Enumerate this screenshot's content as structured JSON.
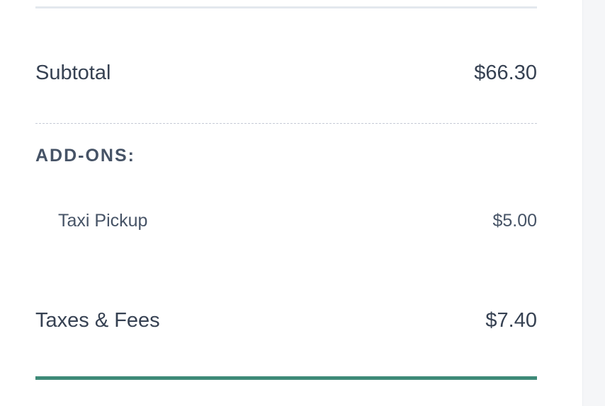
{
  "summary": {
    "subtotal": {
      "label": "Subtotal",
      "value": "$66.30"
    },
    "addons": {
      "heading": "ADD-ONS:",
      "items": [
        {
          "label": "Taxi Pickup",
          "value": "$5.00"
        }
      ]
    },
    "taxes": {
      "label": "Taxes & Fees",
      "value": "$7.40"
    }
  },
  "colors": {
    "text": "#364152",
    "accent_divider": "#3e8a78",
    "top_divider": "#e3e8ee",
    "dashed_divider": "#c6cbd6"
  }
}
